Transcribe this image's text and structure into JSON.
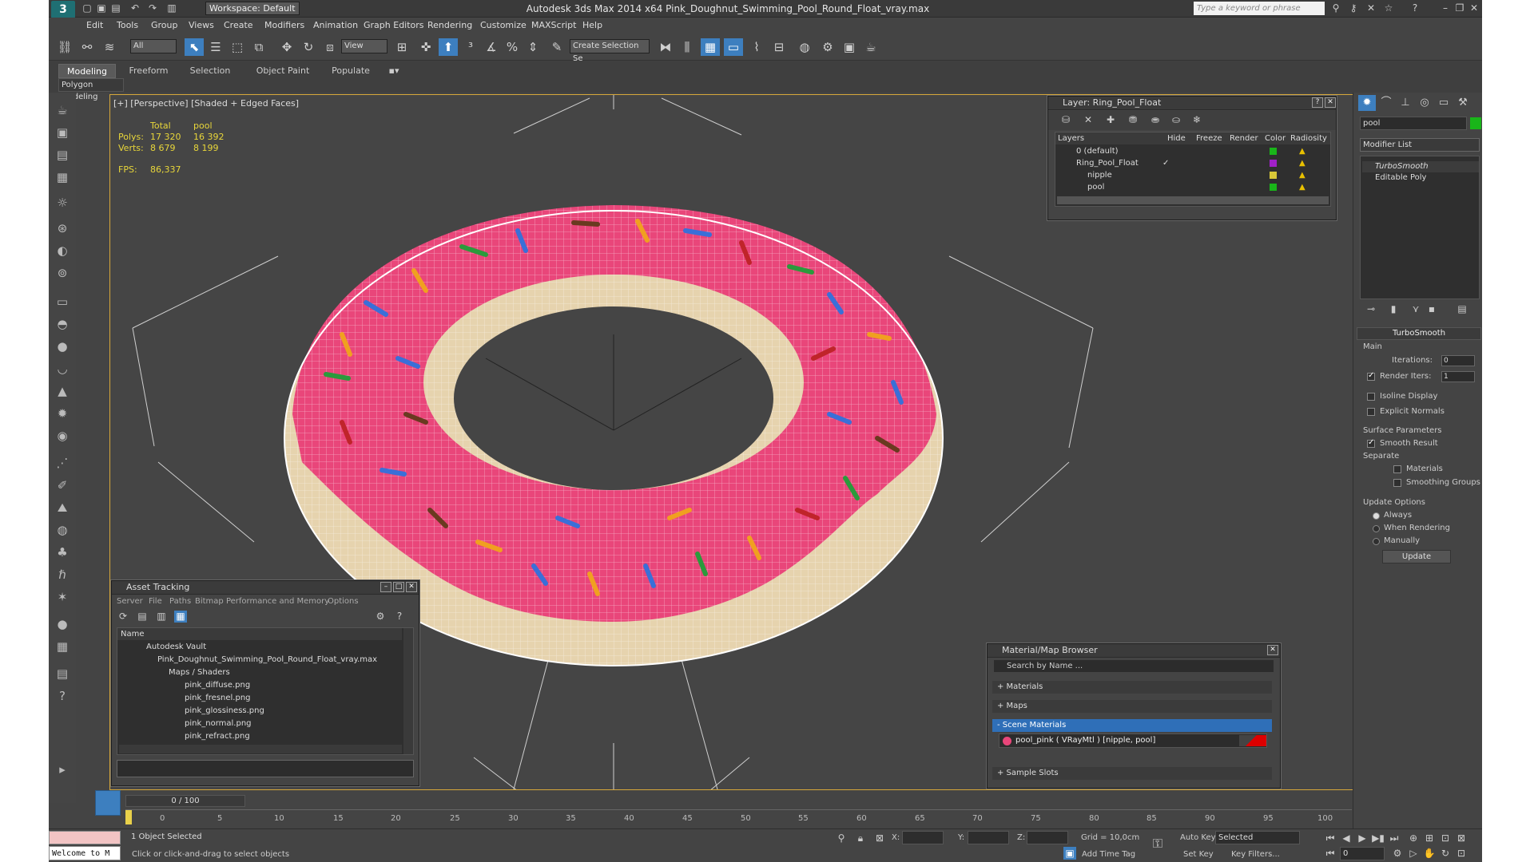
{
  "window": {
    "title": "Autodesk 3ds Max 2014 x64      Pink_Doughnut_Swimming_Pool_Round_Float_vray.max",
    "workspace": "Workspace: Default",
    "search_placeholder": "Type a keyword or phrase"
  },
  "menu": [
    "Edit",
    "Tools",
    "Group",
    "Views",
    "Create",
    "Modifiers",
    "Animation",
    "Graph Editors",
    "Rendering",
    "Customize",
    "MAXScript",
    "Help"
  ],
  "toolbar": {
    "selection_filter": "All",
    "ref_coord": "View",
    "named_selection": "Create Selection Se"
  },
  "ribbon": {
    "tabs": [
      "Modeling",
      "Freeform",
      "Selection",
      "Object Paint",
      "Populate"
    ],
    "active_tab": "Modeling",
    "sub_label": "Polygon Modeling"
  },
  "viewport": {
    "label": "[+] [Perspective] [Shaded + Edged Faces]",
    "stats": {
      "col_total": "Total",
      "col_pool": "pool",
      "polys_label": "Polys:",
      "polys_total": "17 320",
      "polys_pool": "16 392",
      "verts_label": "Verts:",
      "verts_total": "8 679",
      "verts_pool": "8 199",
      "fps_label": "FPS:",
      "fps_value": "86,337"
    },
    "colors": {
      "pink": "#e9467a",
      "cream": "#e6d3ae",
      "bg": "#454545"
    }
  },
  "layer_window": {
    "title": "Layer: Ring_Pool_Float",
    "headers": [
      "Layers",
      "Hide",
      "Freeze",
      "Render",
      "Color",
      "Radiosity"
    ],
    "rows": [
      {
        "name": "0 (default)",
        "color": "#19b519"
      },
      {
        "name": "Ring_Pool_Float",
        "color": "#a020c8"
      },
      {
        "name": "nipple",
        "color": "#d8c838"
      },
      {
        "name": "pool",
        "color": "#19b519"
      }
    ]
  },
  "command_panel": {
    "object_name": "pool",
    "object_color": "#19b519",
    "modifier_list": "Modifier List",
    "stack": [
      "TurboSmooth",
      "Editable Poly"
    ],
    "turbosmooth": {
      "title": "TurboSmooth",
      "main": "Main",
      "iterations_label": "Iterations:",
      "iterations": "0",
      "render_iters_label": "Render Iters:",
      "render_iters": "1",
      "isoline": "Isoline Display",
      "explicit_normals": "Explicit Normals",
      "surface_params": "Surface Parameters",
      "smooth_result": "Smooth Result",
      "separate": "Separate",
      "materials": "Materials",
      "smoothing_groups": "Smoothing Groups",
      "update_options": "Update Options",
      "always": "Always",
      "when_rendering": "When Rendering",
      "manually": "Manually",
      "update": "Update"
    }
  },
  "asset_tracking": {
    "title": "Asset Tracking",
    "menu": [
      "Server",
      "File",
      "Paths",
      "Bitmap Performance and Memory",
      "Options"
    ],
    "col_name": "Name",
    "rows": [
      "Autodesk Vault",
      "Pink_Doughnut_Swimming_Pool_Round_Float_vray.max",
      "Maps / Shaders",
      "pink_diffuse.png",
      "pink_fresnel.png",
      "pink_glossiness.png",
      "pink_normal.png",
      "pink_refract.png"
    ]
  },
  "material_browser": {
    "title": "Material/Map Browser",
    "search": "Search by Name ...",
    "groups": [
      "+ Materials",
      "+ Maps",
      "- Scene Materials",
      "+ Sample Slots"
    ],
    "material": "pool_pink ( VRayMtl ) [nipple, pool]"
  },
  "timeline": {
    "frame": "0 / 100",
    "ticks": [
      "0",
      "5",
      "10",
      "15",
      "20",
      "25",
      "30",
      "35",
      "40",
      "45",
      "50",
      "55",
      "60",
      "65",
      "70",
      "75",
      "80",
      "85",
      "90",
      "95",
      "100"
    ]
  },
  "status": {
    "maxscript": "Welcome to M",
    "selected": "1 Object Selected",
    "prompt": "Click or click-and-drag to select objects",
    "x_label": "X:",
    "y_label": "Y:",
    "z_label": "Z:",
    "grid": "Grid = 10,0cm",
    "add_time_tag": "Add Time Tag",
    "auto_key": "Auto Key",
    "set_key": "Set Key",
    "key_mode": "Selected",
    "key_filters": "Key Filters...",
    "frame_field": "0"
  }
}
